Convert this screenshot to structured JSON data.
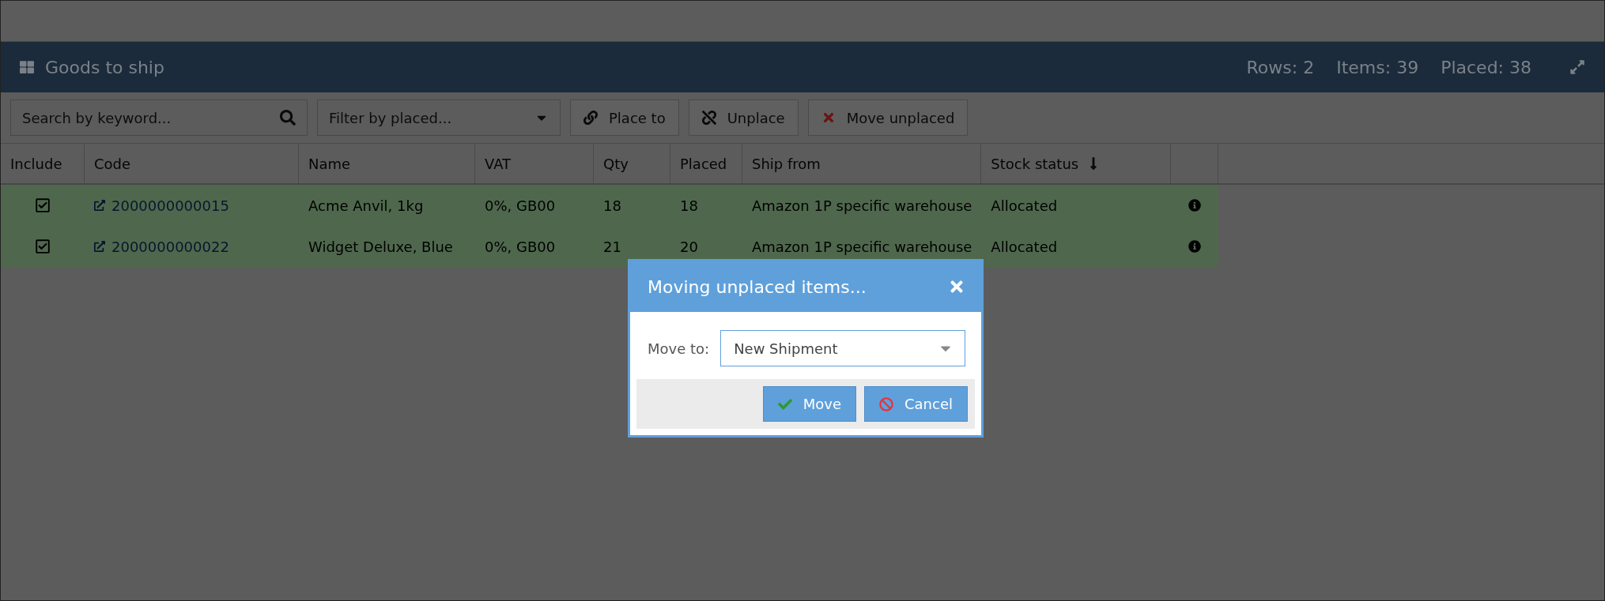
{
  "panel": {
    "title": "Goods to ship",
    "stats": [
      "Rows: 2",
      "Items: 39",
      "Placed: 38"
    ]
  },
  "toolbar": {
    "search": {
      "placeholder": "Search by keyword..."
    },
    "filter": {
      "placeholder": "Filter by placed..."
    },
    "buttons": [
      {
        "label": "Place to",
        "kind": "link"
      },
      {
        "label": "Unplace",
        "kind": "unlink"
      },
      {
        "label": "Move unplaced",
        "kind": "cross"
      }
    ]
  },
  "table": {
    "columns": [
      {
        "label": "Include",
        "sorted": false
      },
      {
        "label": "Code",
        "sorted": false
      },
      {
        "label": "Name",
        "sorted": false
      },
      {
        "label": "VAT",
        "sorted": false
      },
      {
        "label": "Qty",
        "sorted": false
      },
      {
        "label": "Placed",
        "sorted": false
      },
      {
        "label": "Ship from",
        "sorted": false
      },
      {
        "label": "Stock status",
        "sorted": true
      }
    ],
    "rows": [
      {
        "checked": true,
        "code": "2000000000015",
        "name": "Acme Anvil, 1kg",
        "vat": "0%, GB00",
        "qty": "18",
        "placed": "18",
        "ship_from": "Amazon 1P specific warehouse",
        "stock_status": "Allocated"
      },
      {
        "checked": true,
        "code": "2000000000022",
        "name": "Widget Deluxe, Blue",
        "vat": "0%, GB00",
        "qty": "21",
        "placed": "20",
        "ship_from": "Amazon 1P specific warehouse",
        "stock_status": "Allocated"
      }
    ]
  },
  "dialog": {
    "title": "Moving unplaced items...",
    "field_label": "Move to:",
    "field_value": "New Shipment",
    "buttons": [
      {
        "label": "Move",
        "kind": "confirm"
      },
      {
        "label": "Cancel",
        "kind": "cancel"
      }
    ]
  }
}
